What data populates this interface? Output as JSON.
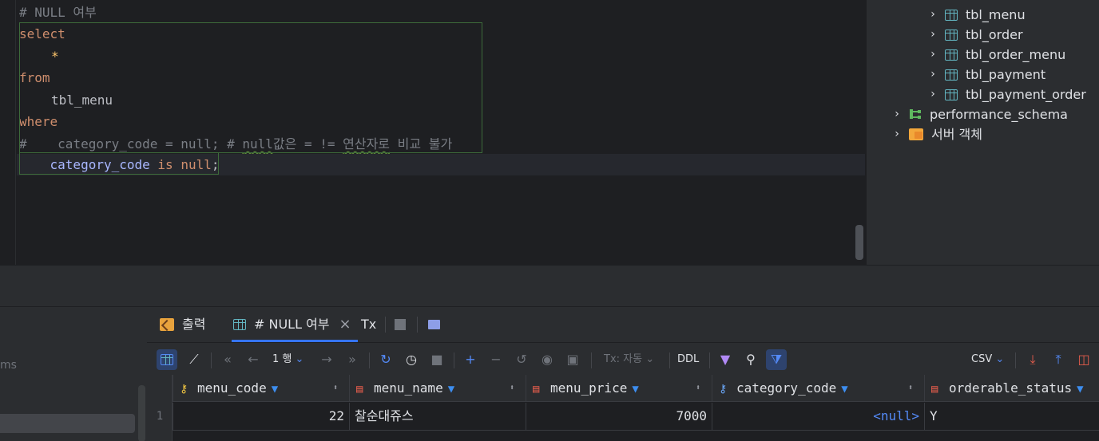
{
  "editor": {
    "lines": {
      "l1": "# NULL 여부",
      "l2": "select",
      "l3": "*",
      "l4": "from",
      "l5": "tbl_menu",
      "l6": "where",
      "l7_hash": "#",
      "l7_a": "category_code = null; # ",
      "l7_null": "null",
      "l7_b": "값은",
      "l7_c": " = != ",
      "l7_d": "연산자로",
      "l7_e": " 비교 불가",
      "l8_col": "category_code",
      "l8_is": "is",
      "l8_null": "null",
      "l8_semi": ";"
    }
  },
  "tree": {
    "items": [
      {
        "label": "tbl_menu"
      },
      {
        "label": "tbl_order"
      },
      {
        "label": "tbl_order_menu"
      },
      {
        "label": "tbl_payment"
      },
      {
        "label": "tbl_payment_order"
      },
      {
        "label": "performance_schema"
      },
      {
        "label": "서버 객체"
      }
    ]
  },
  "left_panel": {
    "fragment": "ms"
  },
  "results": {
    "tabs": {
      "output": "출력",
      "query": "# NULL 여부",
      "close": "×",
      "tx": "Tx"
    },
    "toolbar": {
      "page_label": "1 행",
      "tx_mode": "Tx: 자동",
      "ddl": "DDL",
      "export_format": "CSV"
    },
    "columns": [
      {
        "name": "menu_code",
        "icon": "key-icon"
      },
      {
        "name": "menu_name",
        "icon": "column-icon"
      },
      {
        "name": "menu_price",
        "icon": "column-icon"
      },
      {
        "name": "category_code",
        "icon": "foreign-key-icon"
      },
      {
        "name": "orderable_status",
        "icon": "column-icon"
      }
    ],
    "rows": [
      {
        "num": "1",
        "menu_code": "22",
        "menu_name": "찰순대쥬스",
        "menu_price": "7000",
        "category_code": "<null>",
        "orderable_status": "Y"
      }
    ]
  },
  "colors": {
    "accent": "#3574f0",
    "keyword": "#cf8e6d",
    "comment": "#7a7e85",
    "null_value": "#548af7"
  }
}
